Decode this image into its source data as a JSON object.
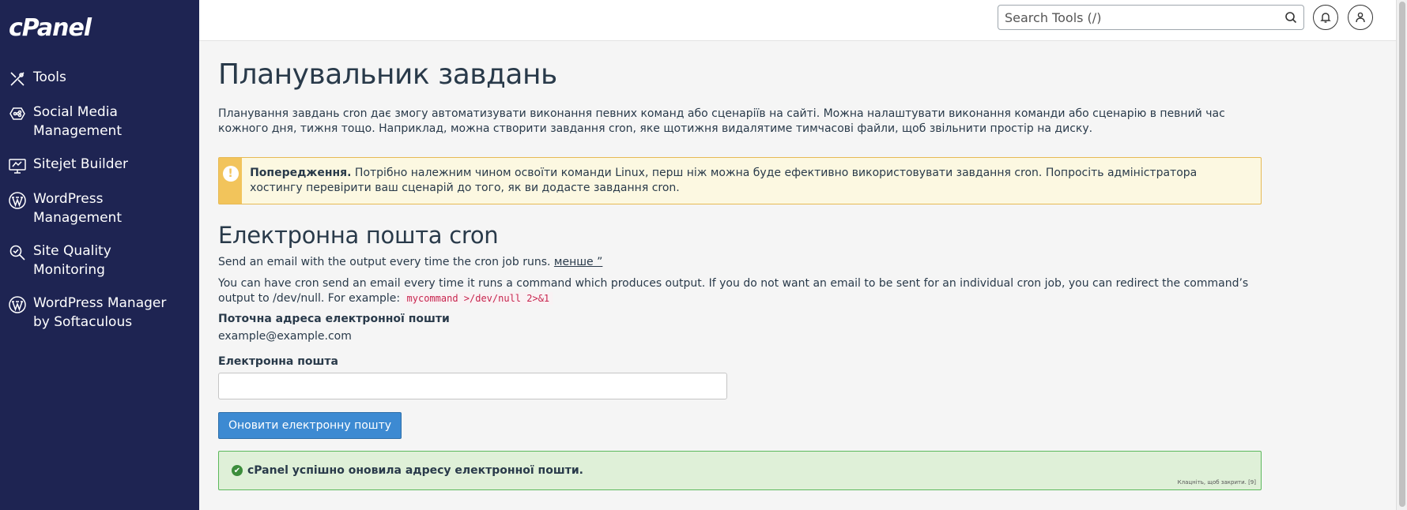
{
  "app": {
    "logo": "cPanel"
  },
  "sidebar": {
    "items": [
      {
        "label": "Tools",
        "icon": "tools-icon"
      },
      {
        "label": "Social Media\nManagement",
        "icon": "social-media-icon"
      },
      {
        "label": "Sitejet Builder",
        "icon": "sitejet-icon"
      },
      {
        "label": "WordPress\nManagement",
        "icon": "wordpress-icon"
      },
      {
        "label": "Site Quality\nMonitoring",
        "icon": "site-quality-icon"
      },
      {
        "label": "WordPress Manager\nby Softaculous",
        "icon": "wordpress-icon"
      }
    ]
  },
  "topbar": {
    "search_placeholder": "Search Tools (/)",
    "search_icon": "search-icon",
    "notifications_icon": "bell-icon",
    "user_icon": "user-icon"
  },
  "page": {
    "title": "Планувальник завдань",
    "intro": "Планування завдань cron дає змогу автоматизувати виконання певних команд або сценаріїв на сайті. Можна налаштувати виконання команди або сценарію в певний час кожного дня, тижня тощо. Наприклад, можна створити завдання cron, яке щотижня видалятиме тимчасові файли, щоб звільнити простір на диску."
  },
  "warning": {
    "icon": "exclamation-icon",
    "title": "Попередження.",
    "text": " Потрібно належним чином освоїти команди Linux, перш ніж можна буде ефективно використовувати завдання cron. Попросіть адміністратора хостингу перевірити ваш сценарій до того, як ви додасте завдання cron."
  },
  "cron_email": {
    "title": "Електронна пошта cron",
    "summary": "Send an email with the output every time the cron job runs.",
    "less_link": "менше ”",
    "details": "You can have cron send an email every time it runs a command which produces output. If you do not want an email to be sent for an individual cron job, you can redirect the command’s output to /dev/null. For example:",
    "example_code": "mycommand >/dev/null 2>&1",
    "current_label": "Поточна адреса електронної пошти",
    "current_value": "example@example.com",
    "email_label": "Електронна пошта",
    "email_value": "",
    "update_button": "Оновити електронну пошту"
  },
  "success": {
    "icon": "check-circle-icon",
    "message": "cPanel успішно оновила адресу електронної пошти.",
    "close_hint": "Клацніть, щоб закрити. [9]"
  },
  "colors": {
    "sidebar_bg": "#1e2452",
    "primary": "#3d8ad2",
    "warning_accent": "#f2c45b",
    "success_border": "#5cb85c"
  }
}
